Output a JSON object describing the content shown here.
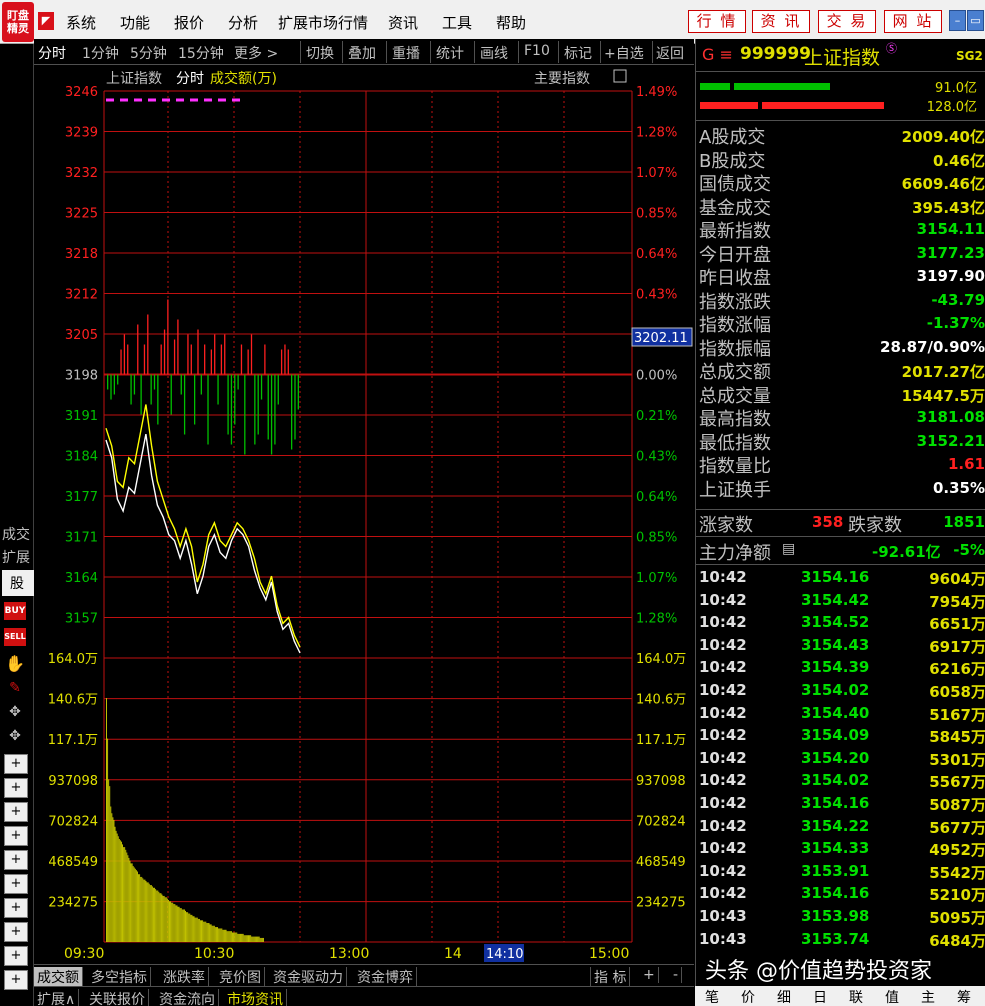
{
  "logo": {
    "line1": "盯盘",
    "line2": "精灵"
  },
  "menu": {
    "items": [
      "系统",
      "功能",
      "报价",
      "分析",
      "扩展市场行情",
      "资讯",
      "工具",
      "帮助"
    ]
  },
  "quick_buttons": [
    "行 情",
    "资 讯",
    "交 易",
    "网 站"
  ],
  "toolbar": {
    "left": [
      "分时",
      "1分钟",
      "5分钟",
      "15分钟",
      "更多 >"
    ],
    "right": [
      "切换",
      "叠加",
      "重播",
      "统计",
      "画线",
      "F10",
      "标记",
      "+自选",
      "返回"
    ]
  },
  "left_strip": {
    "labels": [
      "成交",
      "扩展",
      "股票"
    ],
    "buy": "BUY",
    "sell": "SELL"
  },
  "chart": {
    "header_name": "上证指数",
    "header_mode": "分时",
    "header_indicator": "成交额(万)",
    "main_indicator_btn": "主要指数",
    "price_labels": [
      "3246",
      "3239",
      "3232",
      "3225",
      "3218",
      "3212",
      "3205",
      "3198",
      "3191",
      "3184",
      "3177",
      "3171",
      "3164",
      "3157"
    ],
    "pct_labels": [
      "1.49%",
      "1.28%",
      "1.07%",
      "0.85%",
      "0.64%",
      "0.43%",
      "0.21%",
      "0.00%",
      "0.21%",
      "0.43%",
      "0.64%",
      "0.85%",
      "1.07%",
      "1.28%"
    ],
    "current_price_tag": "3202.11",
    "vol_labels": [
      "164.0万",
      "140.6万",
      "117.1万",
      "937098",
      "702824",
      "468549",
      "234275"
    ],
    "time_labels": [
      "09:30",
      "10:30",
      "13:00",
      "14",
      "15:00"
    ],
    "time_cursor": "14:10",
    "colors": {
      "up": "#ff2020",
      "down": "#00c000",
      "white_line": "#ffffff",
      "yellow_line": "#ffff00",
      "grid": "#c01010",
      "volume": "#c0c000"
    }
  },
  "chart_data": {
    "type": "line",
    "x_start": "09:30",
    "x_end": "15:00",
    "ylim": [
      3157,
      3246
    ],
    "prev_close": 3197.9,
    "series": [
      {
        "values": [
          3187,
          3184,
          3177,
          3175,
          3179,
          3178,
          3183,
          3188,
          3181,
          3176,
          3174,
          3171,
          3170,
          3167,
          3170,
          3166,
          3161,
          3164,
          3169,
          3171,
          3168,
          3167,
          3170,
          3172,
          3171,
          3169,
          3165,
          3162,
          3160,
          3163,
          3158,
          3155,
          3156,
          3153,
          3151
        ]
      },
      {
        "values": [
          3189,
          3186,
          3180,
          3179,
          3184,
          3183,
          3188,
          3193,
          3186,
          3180,
          3177,
          3174,
          3172,
          3169,
          3172,
          3169,
          3163,
          3166,
          3171,
          3173,
          3170,
          3169,
          3171,
          3173,
          3172,
          3170,
          3167,
          3163,
          3161,
          3164,
          3159,
          3156,
          3157,
          3154,
          3152
        ]
      }
    ],
    "breadth_bars": [
      -3,
      -5,
      -4,
      -2,
      5,
      8,
      6,
      -6,
      -4,
      10,
      -8,
      6,
      12,
      -6,
      -3,
      -10,
      6,
      9,
      15,
      -8,
      7,
      11,
      -4,
      -12,
      8,
      6,
      -10,
      9,
      -4,
      6,
      -14,
      5,
      8,
      -6,
      6,
      8,
      -12,
      -14,
      -10,
      -3,
      6,
      -16,
      5,
      8,
      -14,
      -12,
      -5,
      6,
      -13,
      -16,
      -14,
      -6,
      5,
      6,
      5,
      -15,
      -13,
      -7
    ],
    "volume": [
      180,
      150,
      120,
      115,
      100,
      95,
      92,
      90,
      85,
      82,
      80,
      78,
      76,
      75,
      74,
      72,
      70,
      70,
      68,
      66,
      64,
      62,
      60,
      58,
      58,
      56,
      55,
      54,
      53,
      52,
      50,
      50,
      48,
      48,
      47,
      46,
      46,
      45,
      44,
      44,
      43,
      42,
      42,
      41,
      40,
      40,
      39,
      38,
      38,
      37,
      36,
      36,
      35,
      34,
      34,
      33,
      33,
      32,
      31,
      30,
      30,
      29,
      29,
      28,
      28,
      27,
      27,
      26,
      26,
      25,
      25,
      24,
      24,
      24,
      23,
      22,
      22,
      21,
      21,
      20,
      20,
      19,
      19,
      18,
      18,
      18,
      17,
      17,
      16,
      16,
      16,
      15,
      15,
      15,
      14,
      14,
      14,
      13,
      13,
      12,
      12,
      12,
      11,
      11,
      11,
      10,
      10,
      10,
      10,
      9,
      9,
      9,
      9,
      8,
      8,
      8,
      8,
      8,
      7,
      7,
      7,
      7,
      7,
      6,
      6,
      6,
      6,
      6,
      6,
      5,
      5,
      5,
      5,
      5,
      5,
      5,
      4,
      4,
      4,
      4,
      4,
      4,
      4,
      4,
      3,
      3,
      3,
      3
    ],
    "ylabel": "成交额(万)"
  },
  "tabs": {
    "row1": [
      "成交额",
      "多空指标",
      "涨跌率",
      "竞价图",
      "资金驱动力",
      "资金博弈"
    ],
    "indicator": "指 标",
    "plus": "+",
    "minus": "-",
    "row2": [
      "扩展∧",
      "关联报价",
      "资金流向",
      "市场资讯"
    ]
  },
  "quote": {
    "code_prefix": "G ≡",
    "code": "999999",
    "name": "上证指数",
    "sg": "SG2",
    "bar_up": "91.0亿",
    "bar_down": "128.0亿",
    "rows": [
      {
        "label": "A股成交",
        "value": "2009.40亿",
        "color": "#e0e000"
      },
      {
        "label": "B股成交",
        "value": "0.46亿",
        "color": "#e0e000"
      },
      {
        "label": "国债成交",
        "value": "6609.46亿",
        "color": "#e0e000"
      },
      {
        "label": "基金成交",
        "value": "395.43亿",
        "color": "#e0e000"
      },
      {
        "label": "最新指数",
        "value": "3154.11",
        "color": "#00e000"
      },
      {
        "label": "今日开盘",
        "value": "3177.23",
        "color": "#00e000"
      },
      {
        "label": "昨日收盘",
        "value": "3197.90",
        "color": "#ffffff"
      },
      {
        "label": "指数涨跌",
        "value": "-43.79",
        "color": "#00e000"
      },
      {
        "label": "指数涨幅",
        "value": "-1.37%",
        "color": "#00e000"
      },
      {
        "label": "指数振幅",
        "value": "28.87/0.90%",
        "color": "#ffffff"
      },
      {
        "label": "总成交额",
        "value": "2017.27亿",
        "color": "#e0e000"
      },
      {
        "label": "总成交量",
        "value": "15447.5万",
        "color": "#e0e000"
      },
      {
        "label": "最高指数",
        "value": "3181.08",
        "color": "#00e000"
      },
      {
        "label": "最低指数",
        "value": "3152.21",
        "color": "#00e000"
      },
      {
        "label": "指数量比",
        "value": "1.61",
        "color": "#ff2020"
      },
      {
        "label": "上证换手",
        "value": "0.35%",
        "color": "#ffffff"
      }
    ],
    "up_label": "涨家数",
    "up_count": "358",
    "down_label": "跌家数",
    "down_count": "1851",
    "main_flow_label": "主力净额",
    "main_flow_value": "-92.61亿",
    "main_flow_pct": "-5%"
  },
  "ticks": [
    {
      "time": "10:42",
      "price": "3154.16",
      "vol": "9604万"
    },
    {
      "time": "10:42",
      "price": "3154.42",
      "vol": "7954万"
    },
    {
      "time": "10:42",
      "price": "3154.52",
      "vol": "6651万"
    },
    {
      "time": "10:42",
      "price": "3154.43",
      "vol": "6917万"
    },
    {
      "time": "10:42",
      "price": "3154.39",
      "vol": "6216万"
    },
    {
      "time": "10:42",
      "price": "3154.02",
      "vol": "6058万"
    },
    {
      "time": "10:42",
      "price": "3154.40",
      "vol": "5167万"
    },
    {
      "time": "10:42",
      "price": "3154.09",
      "vol": "5845万"
    },
    {
      "time": "10:42",
      "price": "3154.20",
      "vol": "5301万"
    },
    {
      "time": "10:42",
      "price": "3154.02",
      "vol": "5567万"
    },
    {
      "time": "10:42",
      "price": "3154.16",
      "vol": "5087万"
    },
    {
      "time": "10:42",
      "price": "3154.22",
      "vol": "5677万"
    },
    {
      "time": "10:42",
      "price": "3154.33",
      "vol": "4952万"
    },
    {
      "time": "10:42",
      "price": "3153.91",
      "vol": "5542万"
    },
    {
      "time": "10:42",
      "price": "3154.16",
      "vol": "5210万"
    },
    {
      "time": "10:43",
      "price": "3153.98",
      "vol": "5095万"
    },
    {
      "time": "10:43",
      "price": "3153.74",
      "vol": "6484万"
    }
  ],
  "bottom_tabs": [
    "笔",
    "价",
    "细",
    "日",
    "联",
    "值",
    "主",
    "筹"
  ],
  "watermark": "头条 @价值趋势投资家"
}
